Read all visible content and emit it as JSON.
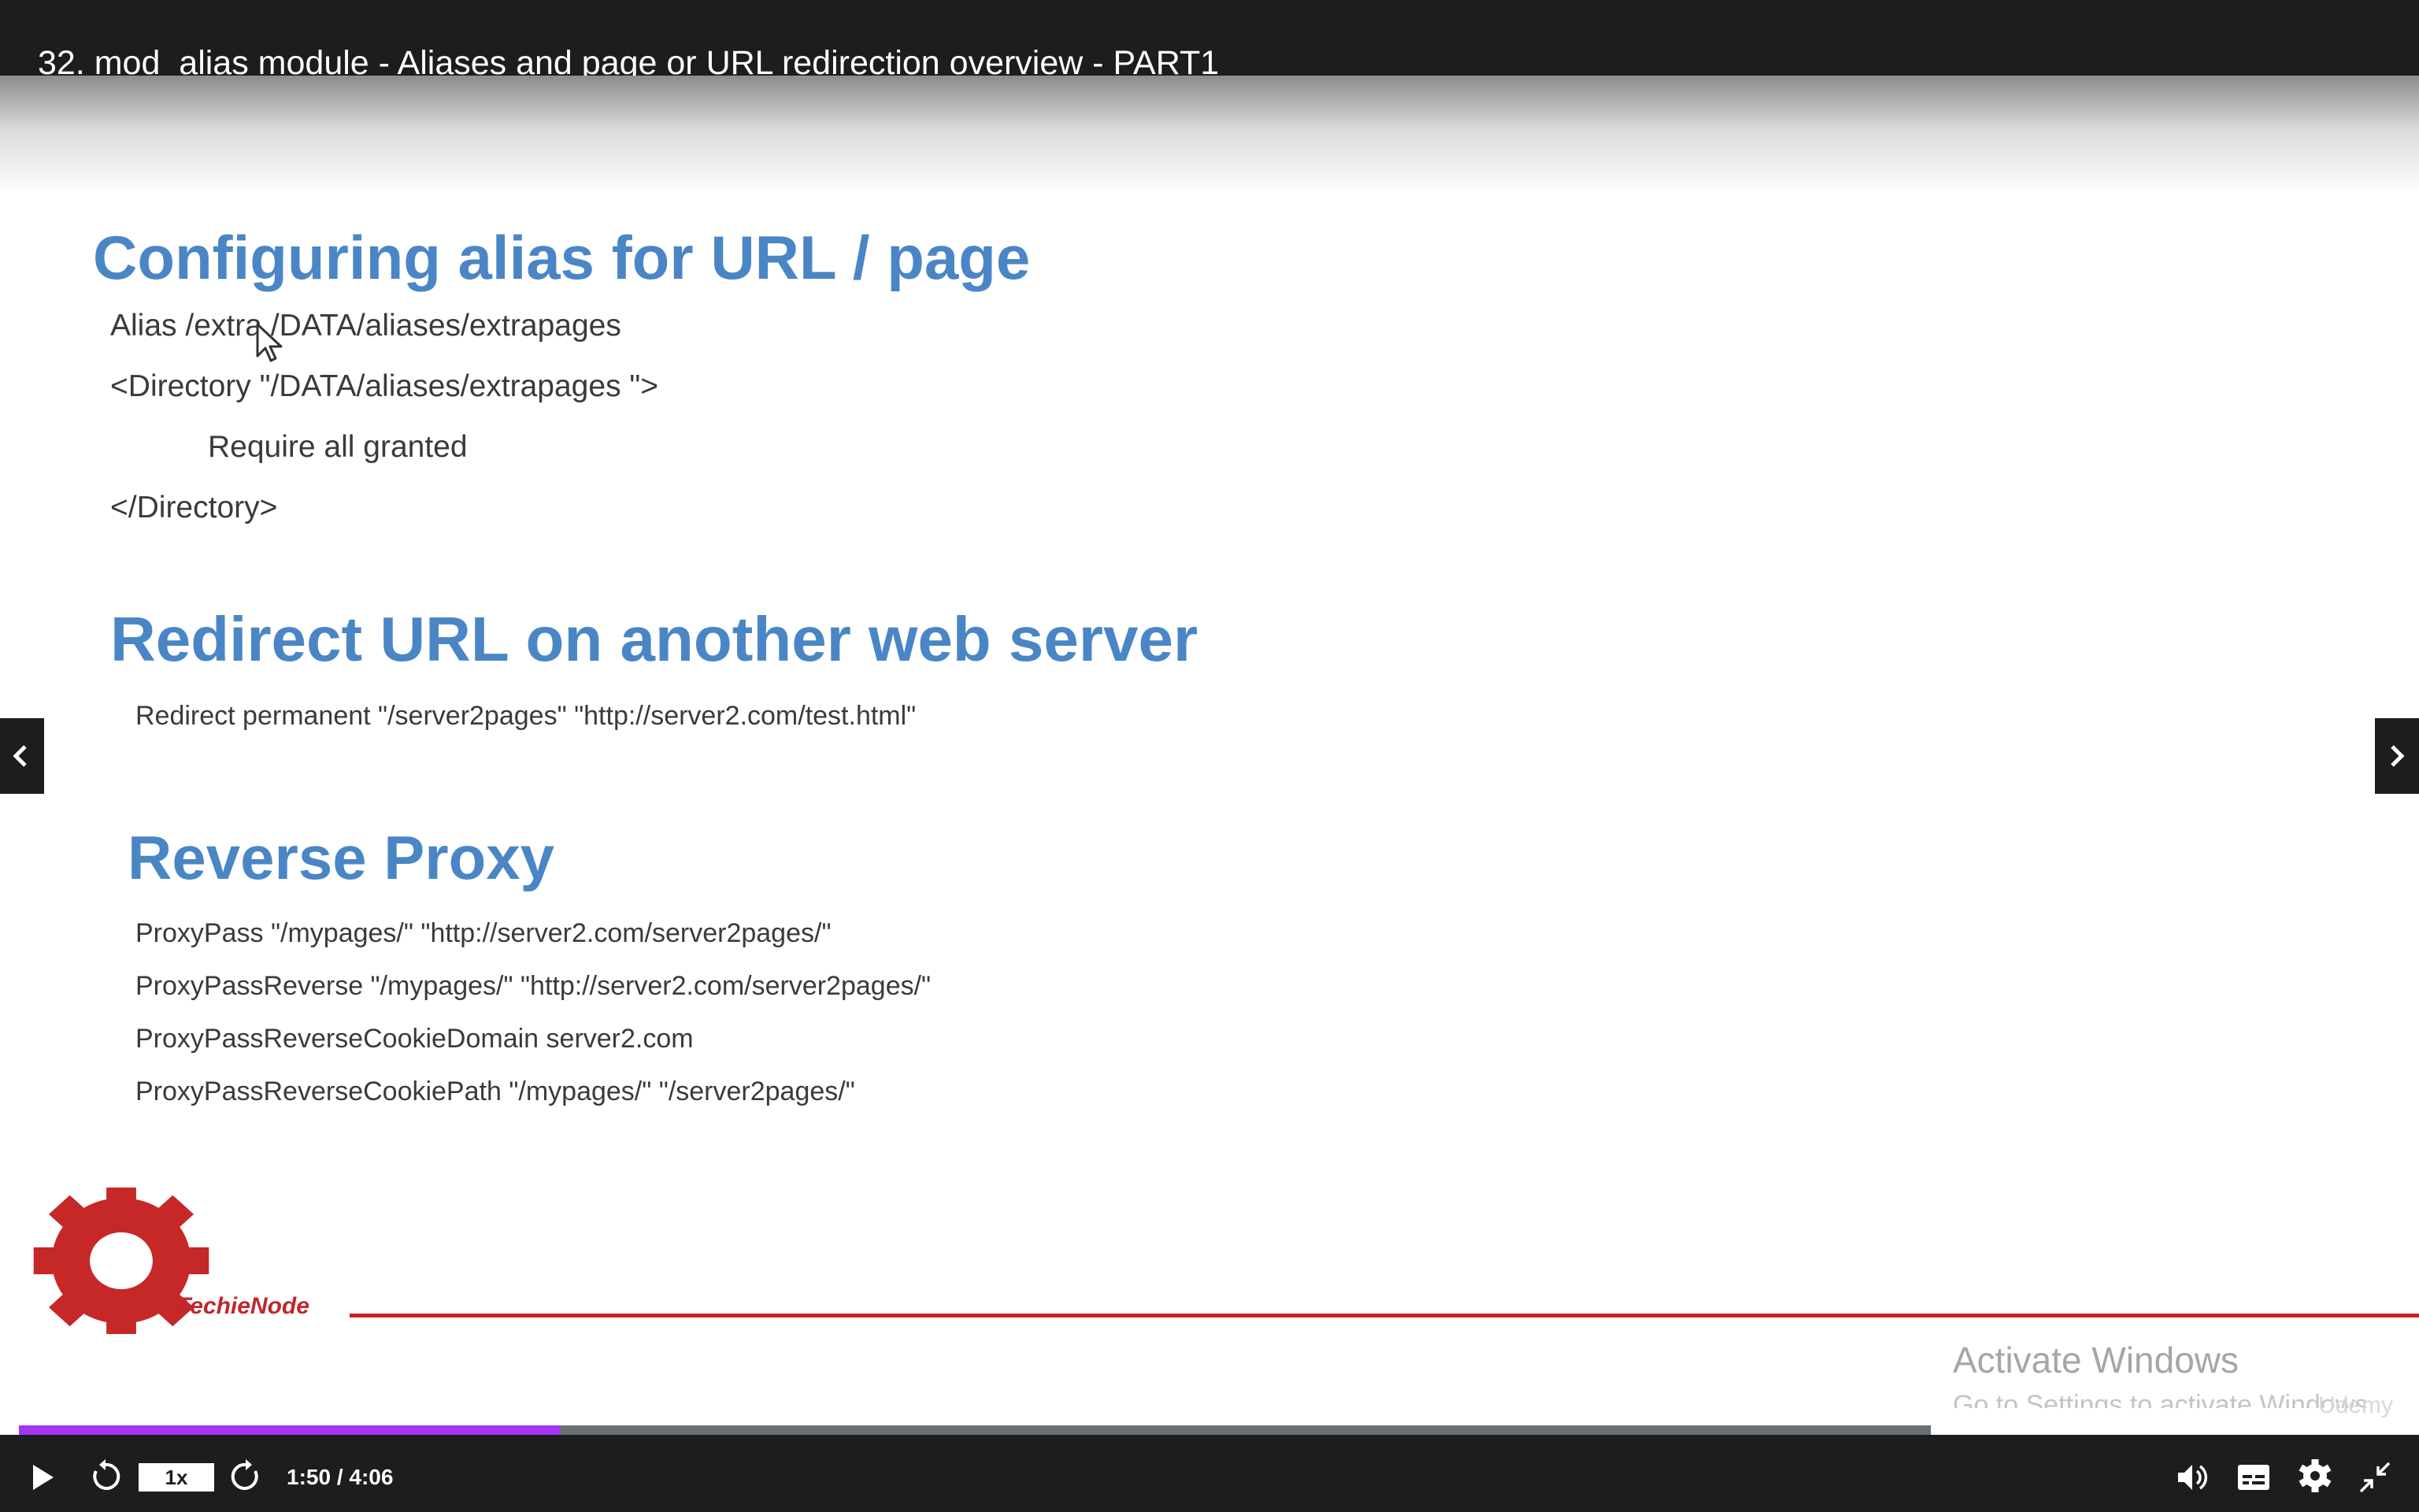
{
  "window": {
    "title": "32. mod_alias module - Aliases and page or URL redirection overview - PART1"
  },
  "slide": {
    "section1": {
      "heading": "Configuring alias for URL / page",
      "lines": [
        "Alias /extra /DATA/aliases/extrapages",
        "<Directory \"/DATA/aliases/extrapages \">",
        "Require all granted",
        "</Directory>"
      ]
    },
    "section2": {
      "heading": "Redirect URL on another web server",
      "lines": [
        "Redirect permanent \"/server2pages\" \"http://server2.com/test.html\""
      ]
    },
    "section3": {
      "heading": "Reverse Proxy",
      "lines": [
        "ProxyPass \"/mypages/\" \"http://server2.com/server2pages/\"",
        "ProxyPassReverse \"/mypages/\" \"http://server2.com/server2pages/\"",
        "ProxyPassReverseCookieDomain server2.com",
        "ProxyPassReverseCookiePath \"/mypages/\" \"/server2pages/\""
      ]
    },
    "logo_text": "TechieNode"
  },
  "overlay": {
    "watermark": "Activate Windows",
    "watermark_sub": "Go to Settings to activate Windows.",
    "brand": "Udemy"
  },
  "player": {
    "speed_label": "1x",
    "time": "1:50 / 4:06",
    "progress": 0.283,
    "played_color": "#a435f0",
    "buffer_color": "#6a6f73",
    "icons": {
      "play": "play-icon",
      "rewind": "rewind-icon",
      "forward": "forward-icon",
      "volume": "volume-icon",
      "captions": "captions-icon",
      "settings": "gear-icon",
      "fullscreen": "exit-fullscreen-icon",
      "prev": "chevron-left-icon",
      "next": "chevron-right-icon"
    }
  }
}
